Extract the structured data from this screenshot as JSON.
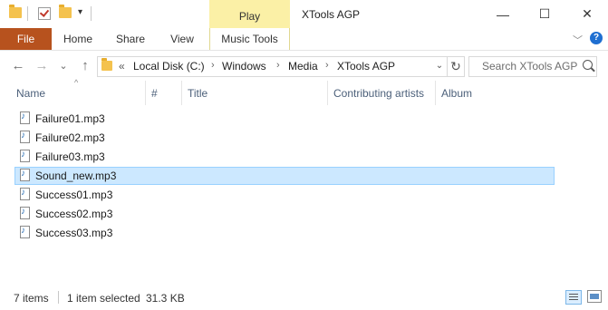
{
  "window": {
    "title": "XTools AGP",
    "context_tab_group": "Play",
    "controls": {
      "minimize": "—",
      "maximize": "☐",
      "close": "✕"
    }
  },
  "quick_access": {
    "customize_glyph": "▾"
  },
  "ribbon": {
    "file_tab": "File",
    "tabs": [
      "Home",
      "Share",
      "View"
    ],
    "context_tab": "Music Tools",
    "expand_glyph": "﹀",
    "help_glyph": "?"
  },
  "nav": {
    "back_glyph": "←",
    "forward_glyph": "→",
    "recent_glyph": "⌄",
    "up_glyph": "↑",
    "overflow_glyph": "«",
    "breadcrumb": [
      "Local Disk (C:)",
      "Windows",
      "Media",
      "XTools AGP"
    ],
    "separator": "›",
    "dropdown_glyph": "⌄",
    "refresh_glyph": "↻"
  },
  "search": {
    "placeholder": "Search XTools AGP"
  },
  "columns": {
    "name": "Name",
    "number": "#",
    "title": "Title",
    "contributing_artists": "Contributing artists",
    "album": "Album",
    "sort_glyph": "^"
  },
  "files": [
    {
      "name": "Failure01.mp3",
      "selected": false
    },
    {
      "name": "Failure02.mp3",
      "selected": false
    },
    {
      "name": "Failure03.mp3",
      "selected": false
    },
    {
      "name": "Sound_new.mp3",
      "selected": true
    },
    {
      "name": "Success01.mp3",
      "selected": false
    },
    {
      "name": "Success02.mp3",
      "selected": false
    },
    {
      "name": "Success03.mp3",
      "selected": false
    }
  ],
  "status": {
    "item_count": "7 items",
    "selection": "1 item selected",
    "size": "31.3 KB"
  },
  "colors": {
    "file_tab": "#b7521e",
    "context_tab_highlight": "#fbf0a6",
    "selection_background": "#cce8ff",
    "selection_border": "#99d1ff",
    "column_header_text": "#4c607a"
  },
  "icons": {
    "quick_access": [
      "folder-icon",
      "properties-check-icon",
      "new-folder-icon"
    ],
    "file": "audio-file-icon",
    "view_modes": [
      "details-view-icon",
      "large-icons-view-icon"
    ]
  }
}
